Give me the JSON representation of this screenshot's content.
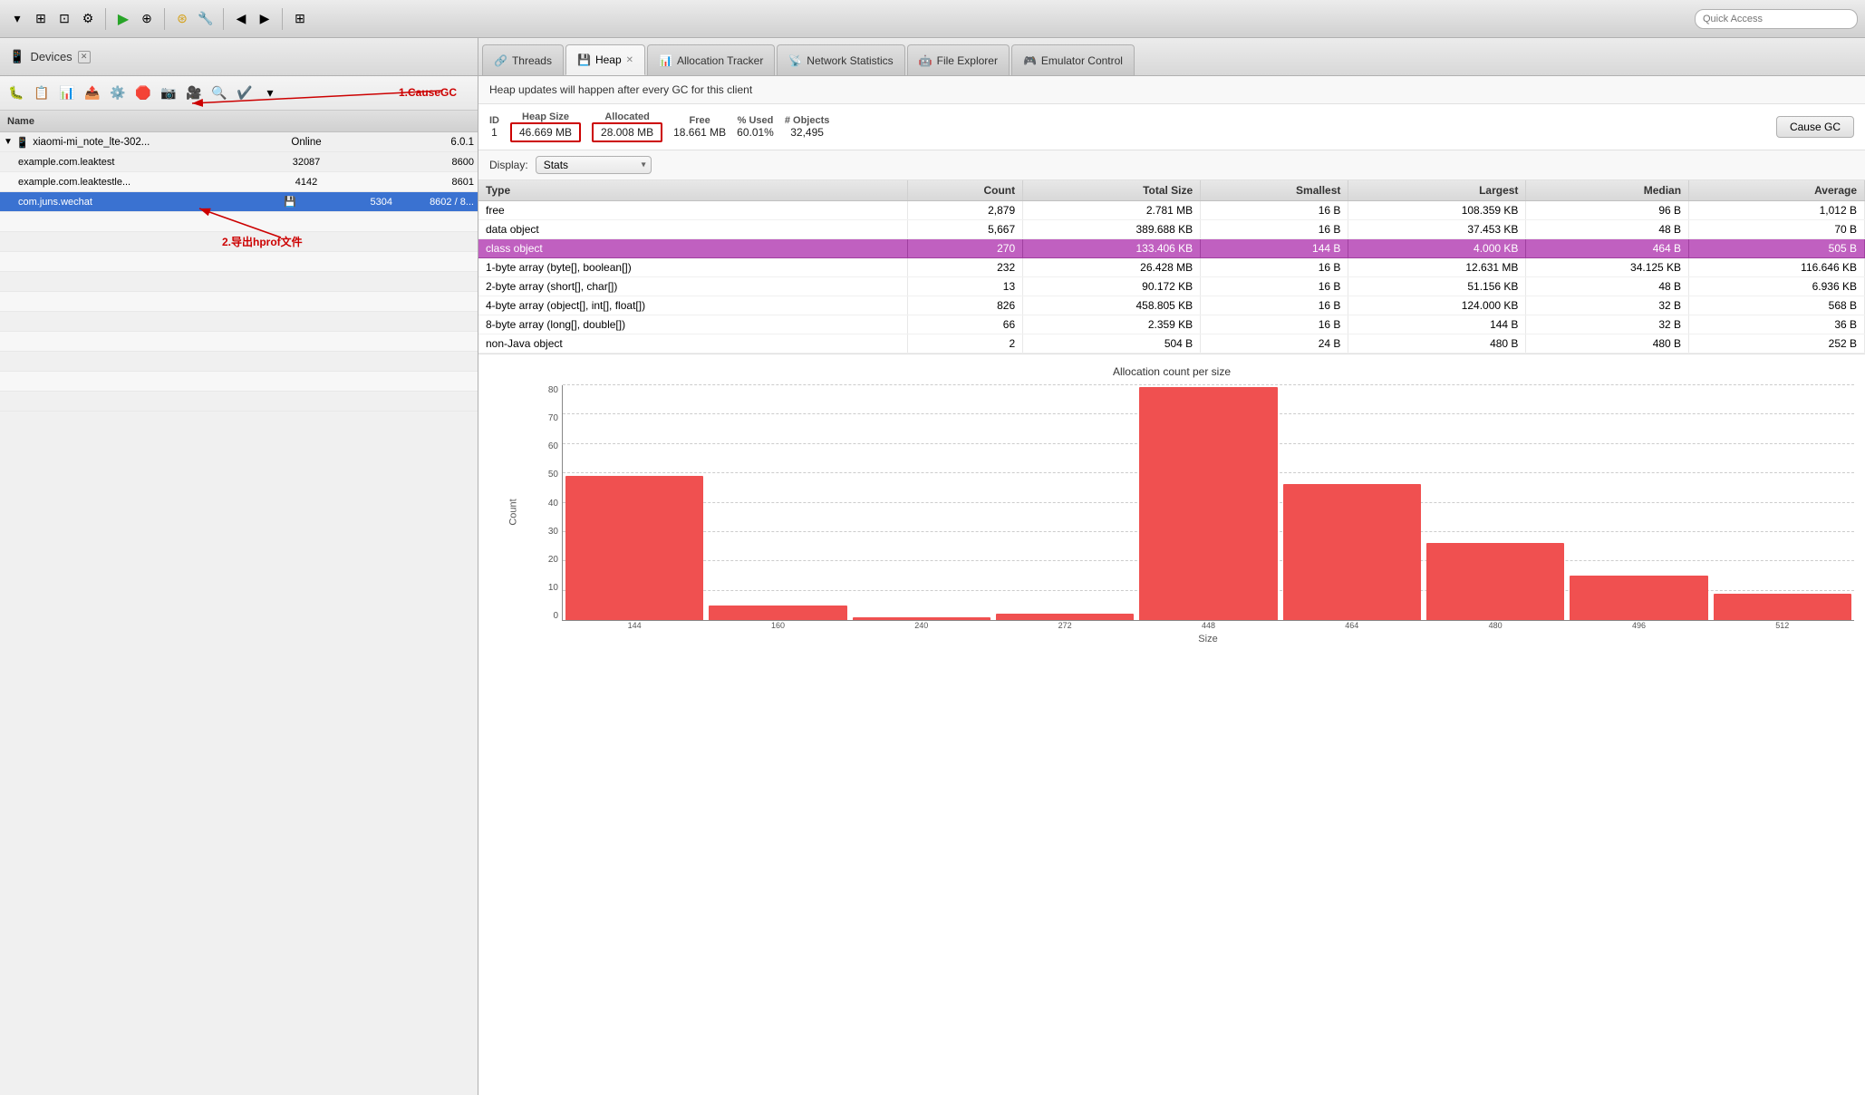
{
  "toolbar": {
    "quick_access_placeholder": "Quick Access"
  },
  "left_panel": {
    "title": "Devices",
    "columns": [
      "Name",
      "",
      "",
      ""
    ],
    "device_name": "xiaomi-mi_note_lte-302...",
    "device_status": "Online",
    "device_port1": "",
    "device_version": "6.0.1",
    "apps": [
      {
        "name": "example.com.leaktest",
        "pid": "32087",
        "port": "8600",
        "extra": ""
      },
      {
        "name": "example.com.leaktestle...",
        "pid": "4142",
        "port": "8601",
        "extra": ""
      },
      {
        "name": "com.juns.wechat",
        "pid": "5304",
        "port": "8602 / 8...",
        "extra": ""
      }
    ],
    "annotation1": "1.CauseGC",
    "annotation2": "2.导出hprof文件"
  },
  "tabs": [
    {
      "id": "threads",
      "label": "Threads",
      "icon": "🔗",
      "closable": false,
      "active": false
    },
    {
      "id": "heap",
      "label": "Heap",
      "icon": "💾",
      "closable": true,
      "active": true
    },
    {
      "id": "allocation_tracker",
      "label": "Allocation Tracker",
      "icon": "📊",
      "closable": false,
      "active": false
    },
    {
      "id": "network_statistics",
      "label": "Network Statistics",
      "icon": "📡",
      "closable": false,
      "active": false
    },
    {
      "id": "file_explorer",
      "label": "File Explorer",
      "icon": "🤖",
      "closable": false,
      "active": false
    },
    {
      "id": "emulator_control",
      "label": "Emulator Control",
      "icon": "🎮",
      "closable": false,
      "active": false
    }
  ],
  "heap": {
    "info_message": "Heap updates will happen after every GC for this client",
    "stats": {
      "id_label": "ID",
      "id_value": "1",
      "heap_size_label": "Heap Size",
      "heap_size_value": "46.669 MB",
      "allocated_label": "Allocated",
      "allocated_value": "28.008 MB",
      "free_label": "Free",
      "free_value": "18.661 MB",
      "pct_used_label": "% Used",
      "pct_used_value": "60.01%",
      "num_objects_label": "# Objects",
      "num_objects_value": "32,495",
      "cause_gc_label": "Cause GC"
    },
    "display": {
      "label": "Display:",
      "selected": "Stats"
    },
    "table": {
      "columns": [
        "Type",
        "Count",
        "Total Size",
        "Smallest",
        "Largest",
        "Median",
        "Average"
      ],
      "rows": [
        {
          "type": "free",
          "count": "2,879",
          "total_size": "2.781 MB",
          "smallest": "16 B",
          "largest": "108.359 KB",
          "median": "96 B",
          "average": "1,012 B",
          "highlighted": false
        },
        {
          "type": "data object",
          "count": "5,667",
          "total_size": "389.688 KB",
          "smallest": "16 B",
          "largest": "37.453 KB",
          "median": "48 B",
          "average": "70 B",
          "highlighted": false
        },
        {
          "type": "class object",
          "count": "270",
          "total_size": "133.406 KB",
          "smallest": "144 B",
          "largest": "4.000 KB",
          "median": "464 B",
          "average": "505 B",
          "highlighted": true
        },
        {
          "type": "1-byte array (byte[], boolean[])",
          "count": "232",
          "total_size": "26.428 MB",
          "smallest": "16 B",
          "largest": "12.631 MB",
          "median": "34.125 KB",
          "average": "116.646 KB",
          "highlighted": false
        },
        {
          "type": "2-byte array (short[], char[])",
          "count": "13",
          "total_size": "90.172 KB",
          "smallest": "16 B",
          "largest": "51.156 KB",
          "median": "48 B",
          "average": "6.936 KB",
          "highlighted": false
        },
        {
          "type": "4-byte array (object[], int[], float[])",
          "count": "826",
          "total_size": "458.805 KB",
          "smallest": "16 B",
          "largest": "124.000 KB",
          "median": "32 B",
          "average": "568 B",
          "highlighted": false
        },
        {
          "type": "8-byte array (long[], double[])",
          "count": "66",
          "total_size": "2.359 KB",
          "smallest": "16 B",
          "largest": "144 B",
          "median": "32 B",
          "average": "36 B",
          "highlighted": false
        },
        {
          "type": "non-Java object",
          "count": "2",
          "total_size": "504 B",
          "smallest": "24 B",
          "largest": "480 B",
          "median": "480 B",
          "average": "252 B",
          "highlighted": false
        }
      ]
    },
    "chart": {
      "title": "Allocation count per size",
      "y_label": "Count",
      "x_label": "Size",
      "y_max": 80,
      "y_ticks": [
        0,
        10,
        20,
        30,
        40,
        50,
        60,
        70,
        80
      ],
      "bars": [
        {
          "label": "144",
          "value": 49
        },
        {
          "label": "160",
          "value": 5
        },
        {
          "label": "240",
          "value": 1
        },
        {
          "label": "272",
          "value": 2
        },
        {
          "label": "448",
          "value": 79
        },
        {
          "label": "464",
          "value": 46
        },
        {
          "label": "480",
          "value": 26
        },
        {
          "label": "496",
          "value": 15
        },
        {
          "label": "512",
          "value": 9
        }
      ]
    }
  }
}
